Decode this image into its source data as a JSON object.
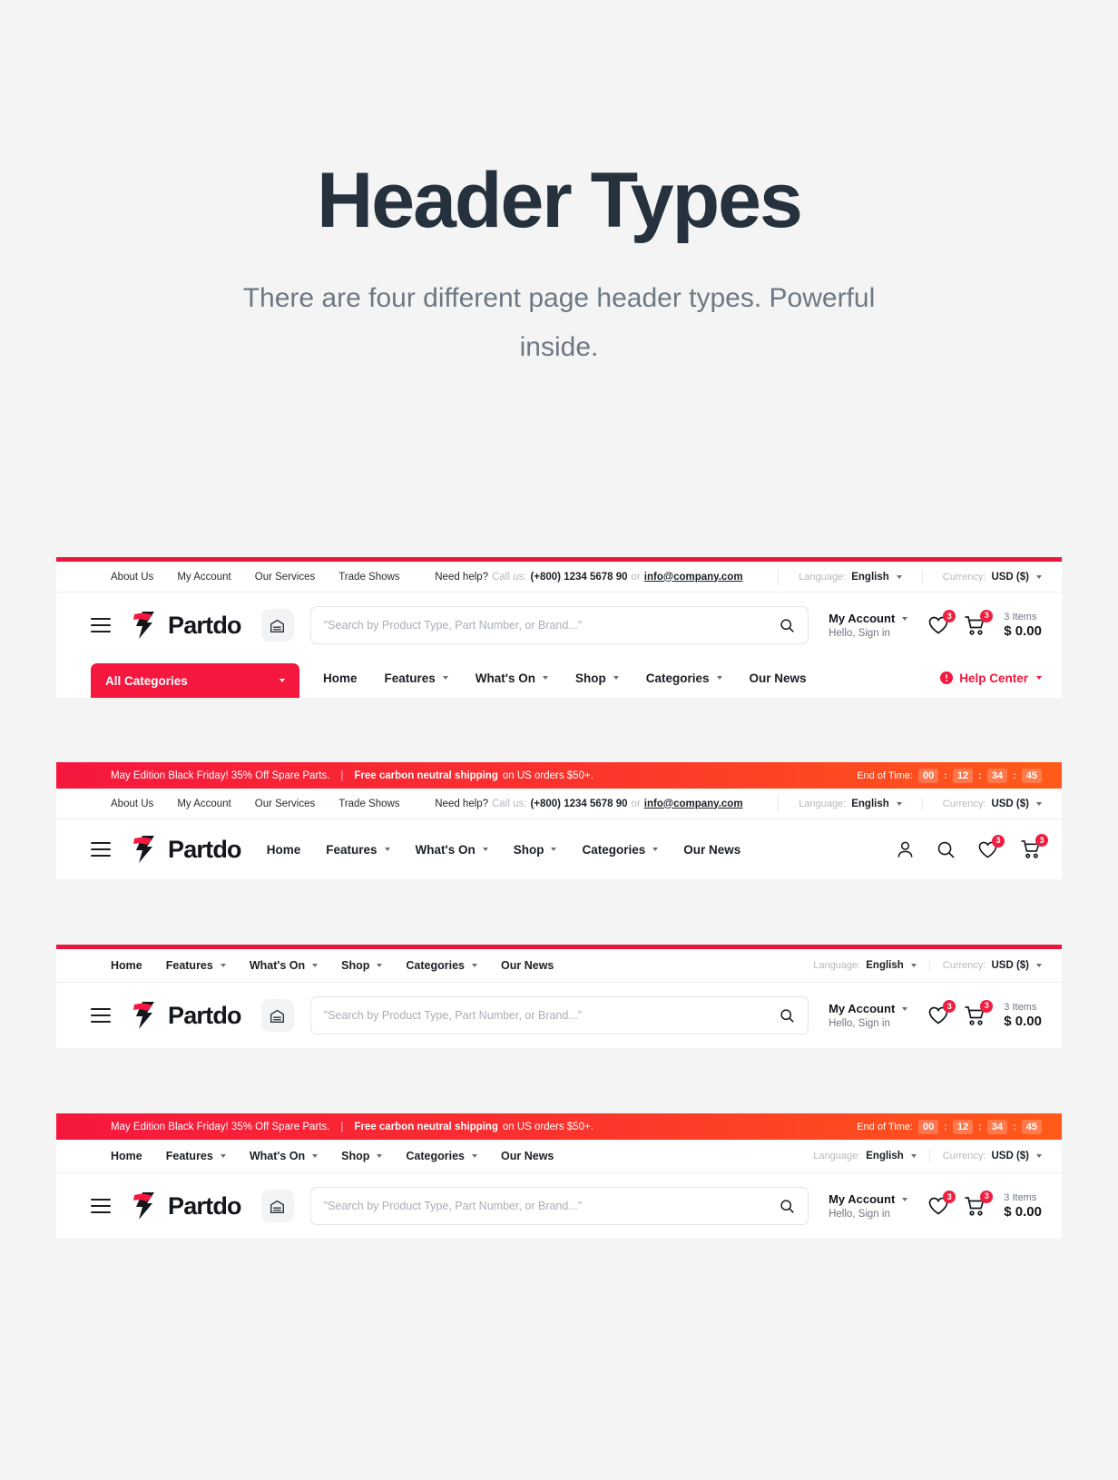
{
  "hero": {
    "title": "Header Types",
    "subtitle": "There are four different page header types. Powerful inside."
  },
  "brand": {
    "name": "Partdo",
    "accent": "#f5173e",
    "banner_accent_end": "#ff5a19"
  },
  "utility": {
    "links": [
      "About Us",
      "My Account",
      "Our Services",
      "Trade Shows"
    ],
    "help_label": "Need help?",
    "call_label": "Call us:",
    "phone": "(+800) 1234 5678 90",
    "or_label": "or",
    "email": "info@company.com",
    "language_caption": "Language:",
    "language_value": "English",
    "currency_caption": "Currency:",
    "currency_value": "USD ($)"
  },
  "search": {
    "placeholder": "\"Search by Product Type, Part Number, or Brand...\""
  },
  "account": {
    "title": "My Account",
    "subtitle": "Hello, Sign in"
  },
  "wishlist": {
    "badge": "3"
  },
  "cart": {
    "badge": "3",
    "items": "3 Items",
    "total": "$ 0.00"
  },
  "nav": {
    "all_categories": "All Categories",
    "items": [
      {
        "label": "Home",
        "caret": false
      },
      {
        "label": "Features",
        "caret": true
      },
      {
        "label": "What's On",
        "caret": true
      },
      {
        "label": "Shop",
        "caret": true
      },
      {
        "label": "Categories",
        "caret": true
      },
      {
        "label": "Our News",
        "caret": false
      }
    ],
    "help_center": "Help Center"
  },
  "promo": {
    "text_1": "May Edition Black Friday! 35% Off Spare Parts.",
    "text_2": "Free carbon neutral shipping",
    "text_3": "on US orders $50+.",
    "timer_label": "End of Time:",
    "timer": [
      "00",
      "12",
      "34",
      "45"
    ],
    "timer_sep": ":"
  },
  "icons": {
    "menu": "hamburger-icon",
    "garage": "garage-icon",
    "search": "search-icon",
    "user": "user-icon",
    "heart": "heart-icon",
    "cart": "cart-icon",
    "help": "help-circle-icon"
  }
}
